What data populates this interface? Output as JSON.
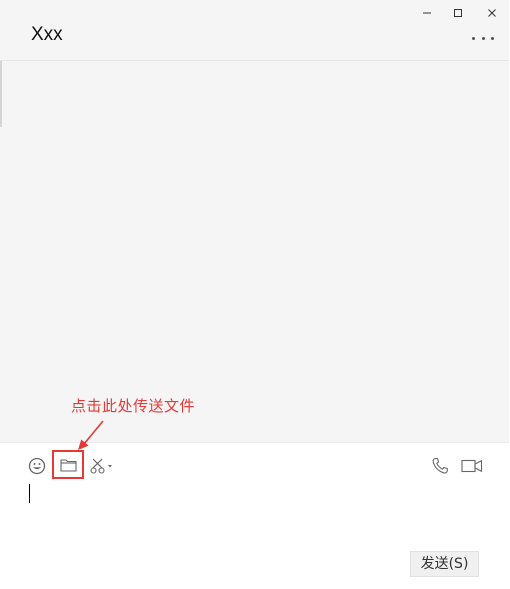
{
  "window": {
    "title": "Xxx",
    "controls": [
      "minimize-icon",
      "maximize-icon",
      "close-icon"
    ],
    "more_icon": "more-options-icon"
  },
  "annotation": {
    "text": "点击此处传送文件",
    "color": "#e53935"
  },
  "toolbar": {
    "left_icons": [
      "emoji-icon",
      "folder-icon",
      "scissors-icon"
    ],
    "right_icons": [
      "phone-icon",
      "video-camera-icon"
    ]
  },
  "composer": {
    "value": "",
    "send_label": "发送(S)"
  }
}
